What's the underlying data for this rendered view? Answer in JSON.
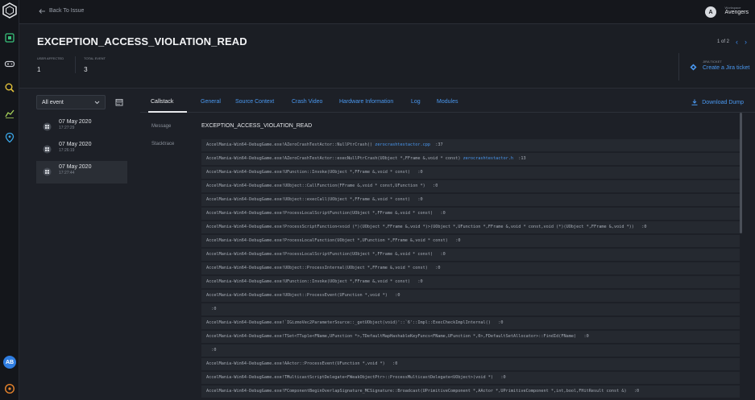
{
  "rail": {
    "avatar_initials": "AB"
  },
  "topbar": {
    "back_label": "Back To Issue",
    "workspace_label": "Workspace",
    "workspace_name": "Avengers",
    "workspace_initial": "A"
  },
  "issue": {
    "title": "EXCEPTION_ACCESS_VIOLATION_READ",
    "pager": "1 of 2",
    "users_affected_label": "USER AFFECTED",
    "users_affected": "1",
    "total_event_label": "TOTAL EVENT",
    "total_event": "3",
    "jira_label": "JIRA TICKET",
    "jira_link": "Create a Jira ticket"
  },
  "events": {
    "filter": "All event",
    "items": [
      {
        "date": "07 May 2020",
        "time": "17:27:29"
      },
      {
        "date": "07 May 2020",
        "time": "17:26:19"
      },
      {
        "date": "07 May 2020",
        "time": "17:27:44"
      }
    ]
  },
  "tabs": [
    "Callstack",
    "General",
    "Source Context",
    "Crash Video",
    "Hardware Information",
    "Log",
    "Modules"
  ],
  "download_label": "Download Dump",
  "detail": {
    "message_label": "Message",
    "message": "EXCEPTION_ACCESS_VIOLATION_READ",
    "stacktrace_label": "Stacktrace"
  },
  "stacktrace": [
    {
      "text": "AccelMania-Win64-DebugGame.exe!AZeroCrashTestActor::NullPtrCrash() ",
      "file": "zerocrashtestactor.cpp",
      "line": ":37"
    },
    {
      "text": "AccelMania-Win64-DebugGame.exe!AZeroCrashTestActor::execNullPtrCrash(UObject *,FFrame &,void * const) ",
      "file": "zerocrashtestactor.h",
      "line": ":13"
    },
    {
      "text": "AccelMania-Win64-DebugGame.exe!UFunction::Invoke(UObject *,FFrame &,void * const)   :0"
    },
    {
      "text": "AccelMania-Win64-DebugGame.exe!UObject::CallFunction(FFrame &,void * const,UFunction *)   :0"
    },
    {
      "text": "AccelMania-Win64-DebugGame.exe!UObject::execCall(UObject *,FFrame &,void * const)   :0"
    },
    {
      "text": "AccelMania-Win64-DebugGame.exe!ProcessLocalScriptFunction(UObject *,FFrame &,void * const)   :0"
    },
    {
      "text": "AccelMania-Win64-DebugGame.exe!ProcessScriptFunction<void (*)(UObject *,FFrame &,void *)>(UObject *,UFunction *,FFrame &,void * const,void (*)(UObject *,FFrame &,void *))   :0"
    },
    {
      "text": "AccelMania-Win64-DebugGame.exe!ProcessLocalFunction(UObject *,UFunction *,FFrame &,void * const)   :0"
    },
    {
      "text": "AccelMania-Win64-DebugGame.exe!ProcessLocalScriptFunction(UObject *,FFrame &,void * const)   :0"
    },
    {
      "text": "AccelMania-Win64-DebugGame.exe!UObject::ProcessInternal(UObject *,FFrame &,void * const)   :0"
    },
    {
      "text": "AccelMania-Win64-DebugGame.exe!UFunction::Invoke(UObject *,FFrame &,void * const)   :0"
    },
    {
      "text": "AccelMania-Win64-DebugGame.exe!UObject::ProcessEvent(UFunction *,void *)   :0"
    },
    {
      "text": "  :0"
    },
    {
      "text": "AccelMania-Win64-DebugGame.exe!`IGizmoVec2ParameterSource::_getUObject(void)'::`6'::Impl::ExecCheckImplInternal()   :0"
    },
    {
      "text": "AccelMania-Win64-DebugGame.exe!TSet<TTuple<FName,UFunction *>,TDefaultMapHashableKeyFuncs<FName,UFunction *,0>,FDefaultSetAllocator>::FindId(FName)   :0"
    },
    {
      "text": "  :0"
    },
    {
      "text": "AccelMania-Win64-DebugGame.exe!AActor::ProcessEvent(UFunction *,void *)   :0"
    },
    {
      "text": "AccelMania-Win64-DebugGame.exe!TMulticastScriptDelegate<FWeakObjectPtr>::ProcessMulticastDelegate<UObject>(void *)   :0"
    },
    {
      "text": "AccelMania-Win64-DebugGame.exe!FComponentBeginOverlapSignature_MCSignature::Broadcast(UPrimitiveComponent *,AActor *,UPrimitiveComponent *,int,bool,FHitResult const &)   :0"
    }
  ]
}
